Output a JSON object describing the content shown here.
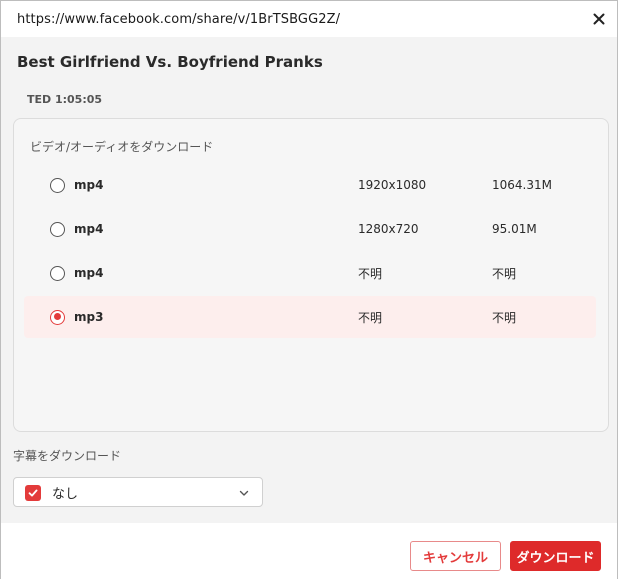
{
  "window": {
    "url": "https://www.facebook.com/share/v/1BrTSBGG2Z/"
  },
  "video": {
    "title": "Best Girlfriend Vs. Boyfriend Pranks",
    "meta": "TED 1:05:05"
  },
  "download_panel": {
    "heading": "ビデオ/オーディオをダウンロード",
    "options": [
      {
        "format": "mp4",
        "resolution": "1920x1080",
        "size": "1064.31M",
        "selected": false
      },
      {
        "format": "mp4",
        "resolution": "1280x720",
        "size": "95.01M",
        "selected": false
      },
      {
        "format": "mp4",
        "resolution": "不明",
        "size": "不明",
        "selected": false
      },
      {
        "format": "mp3",
        "resolution": "不明",
        "size": "不明",
        "selected": true
      }
    ]
  },
  "subtitles": {
    "heading": "字幕をダウンロード",
    "value": "なし",
    "checked": true
  },
  "footer": {
    "cancel_label": "キャンセル",
    "download_label": "ダウンロード"
  },
  "colors": {
    "accent": "#de2a2a",
    "selected_row_bg": "#fdeeed"
  },
  "icons": {
    "close": "close-icon",
    "chevron": "chevron-down-icon",
    "check": "check-icon"
  }
}
